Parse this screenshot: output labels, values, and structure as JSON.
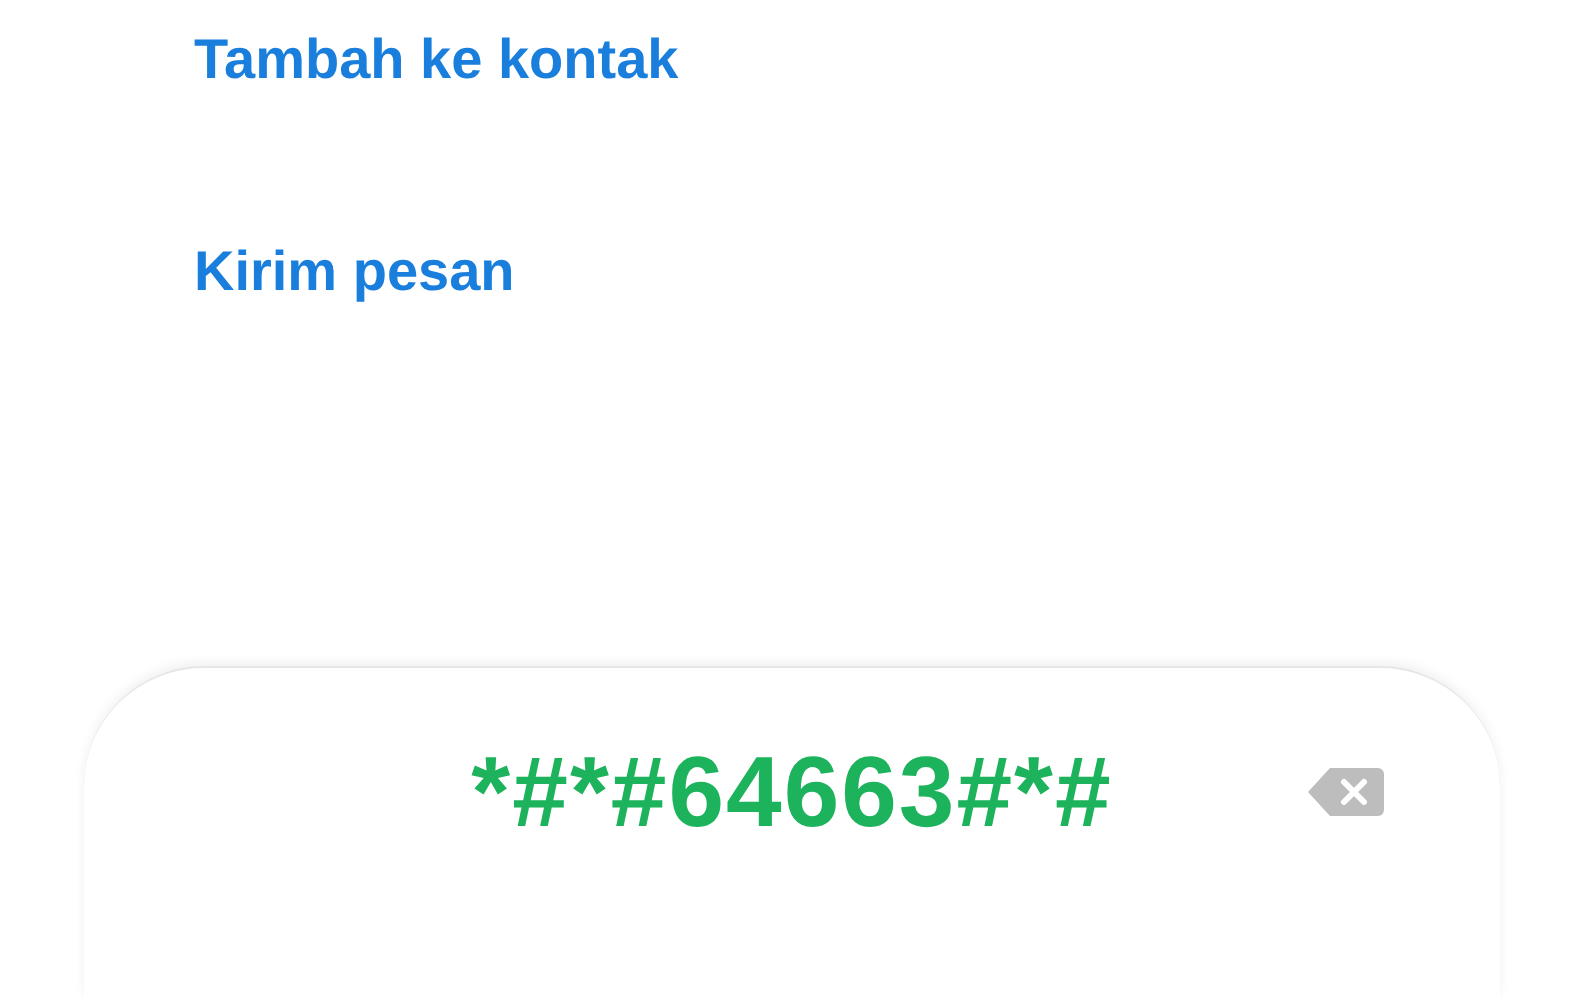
{
  "actions": [
    {
      "label": "Tambah ke kontak"
    },
    {
      "label": "Kirim pesan"
    }
  ],
  "dial_input": {
    "value": "*#*#64663#*#"
  }
}
